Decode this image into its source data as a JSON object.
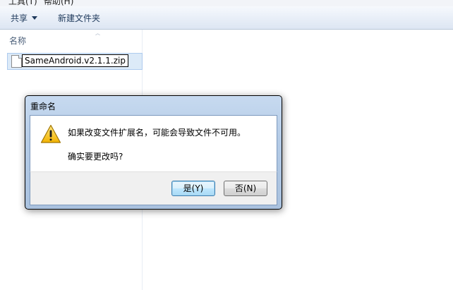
{
  "menubar": {
    "tools": "工具(T)",
    "help": "帮助(H)"
  },
  "toolbar": {
    "share_label": "共享",
    "new_folder_label": "新建文件夹"
  },
  "list": {
    "column_name": "名称",
    "file_name_edit": "SameAndroid.v2.1.1.zip"
  },
  "dialog": {
    "title": "重命名",
    "icon": "warning-icon",
    "message": "如果改变文件扩展名，可能会导致文件不可用。",
    "question": "确实要更改吗?",
    "yes_label": "是(Y)",
    "no_label": "否(N)"
  }
}
